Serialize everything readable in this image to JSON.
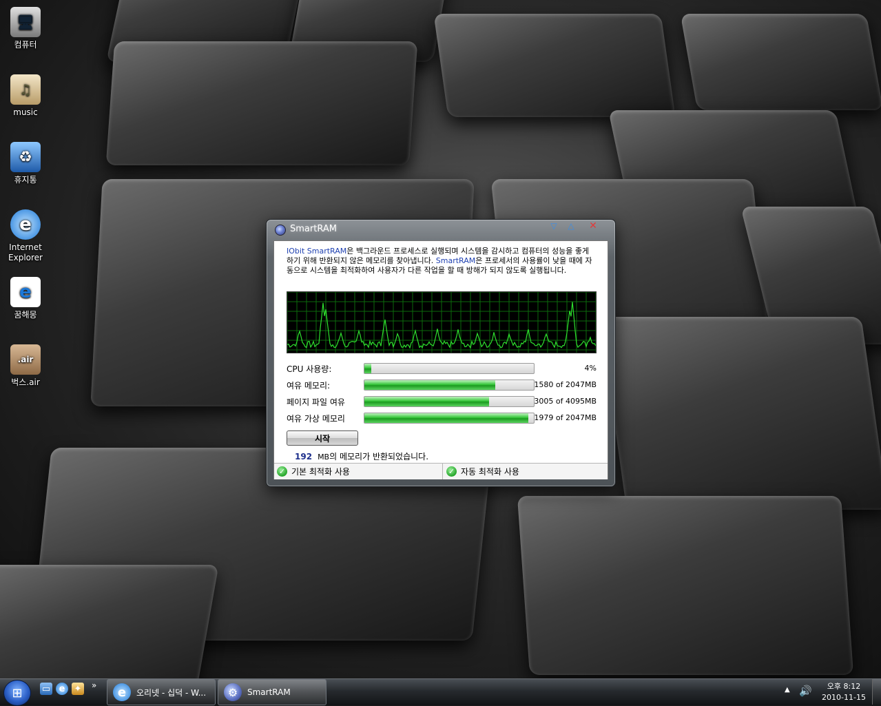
{
  "desktop": {
    "icons": [
      {
        "label": "컴퓨터",
        "icon": "computer-icon"
      },
      {
        "label": "music",
        "icon": "music-folder-icon"
      },
      {
        "label": "휴지통",
        "icon": "recycle-bin-icon"
      },
      {
        "label": "Internet\nExplorer",
        "icon": "internet-explorer-icon"
      },
      {
        "label": "꿈해몽",
        "icon": "ie-shortcut-icon"
      },
      {
        "label": "벅스.air",
        "icon": "air-package-icon"
      }
    ]
  },
  "window": {
    "title": "SmartRAM",
    "description_brand1": "IObit SmartRAM",
    "description_part1": "은 백그라운드 프로세스로 실행되며 시스템을 감시하고 컴퓨터의 성능을 좋게 하기 위해 반환되지 않은 메모리를 찾아냅니다. ",
    "description_brand2": "SmartRAM",
    "description_part2": "은 프로세서의 사용률이 낮을 때에 자동으로 시스템을 최적화하여 사용자가 다른 작업을 할 때 방해가 되지 않도록 실행됩니다.",
    "stats": [
      {
        "label": "CPU 사용량:",
        "value": "4%",
        "fill": 0.04
      },
      {
        "label": "여유 메모리:",
        "value": "1580 of 2047MB",
        "fill": 0.772
      },
      {
        "label": "페이지 파일 여유",
        "value": "3005 of 4095MB",
        "fill": 0.734
      },
      {
        "label": "여유 가상 메모리",
        "value": "1979 of 2047MB",
        "fill": 0.967
      }
    ],
    "start_button": "시작",
    "freed_amount": "192",
    "freed_unit": "MB",
    "freed_text": "의 메모리가 반환되었습니다.",
    "status": {
      "basic": "기본 최적화 사용",
      "auto": "자동 최적화 사용"
    },
    "colors": {
      "graph_line": "#2ee02e",
      "graph_grid": "#0c6a0c",
      "bar_fill": "#36c63a"
    }
  },
  "taskbar": {
    "quick_launch_more": "»",
    "tasks": [
      {
        "label": "오리넷 - 십덕 - W...",
        "icon": "internet-explorer-icon"
      },
      {
        "label": "SmartRAM",
        "icon": "smartram-gear-icon"
      }
    ],
    "clock_time": "오후 8:12",
    "clock_date": "2010-11-15"
  }
}
